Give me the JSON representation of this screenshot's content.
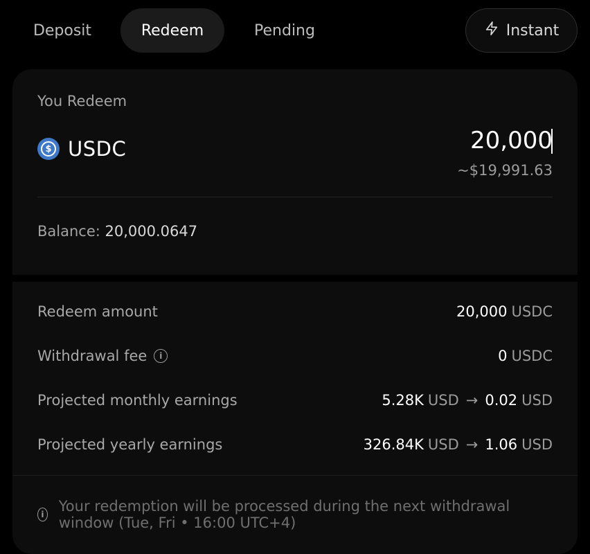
{
  "tabs": {
    "deposit": "Deposit",
    "redeem": "Redeem",
    "pending": "Pending",
    "instant": "Instant"
  },
  "icons": {
    "instant": "lightning-icon",
    "token": "usdc-icon",
    "info": "info-icon"
  },
  "colors": {
    "background": "#000000",
    "card": "#0d0d0d",
    "tab_active": "#1b1b1b",
    "usdc_blue": "#3f78c7"
  },
  "redeem_card": {
    "label": "You Redeem",
    "token": "USDC",
    "amount": "20,000",
    "usd_estimate": "~$19,991.63",
    "balance_label": "Balance:",
    "balance_value": "20,000.0647"
  },
  "summary": {
    "redeem_amount": {
      "label": "Redeem amount",
      "value": "20,000",
      "unit": "USDC"
    },
    "withdrawal_fee": {
      "label": "Withdrawal fee",
      "value": "0",
      "unit": "USDC"
    },
    "monthly": {
      "label": "Projected monthly earnings",
      "from": "5.28K",
      "from_unit": "USD",
      "arrow": "→",
      "to": "0.02",
      "to_unit": "USD"
    },
    "yearly": {
      "label": "Projected yearly earnings",
      "from": "326.84K",
      "from_unit": "USD",
      "arrow": "→",
      "to": "1.06",
      "to_unit": "USD"
    }
  },
  "notice": "Your redemption will be processed during the next withdrawal window (Tue, Fri • 16:00 UTC+4)"
}
